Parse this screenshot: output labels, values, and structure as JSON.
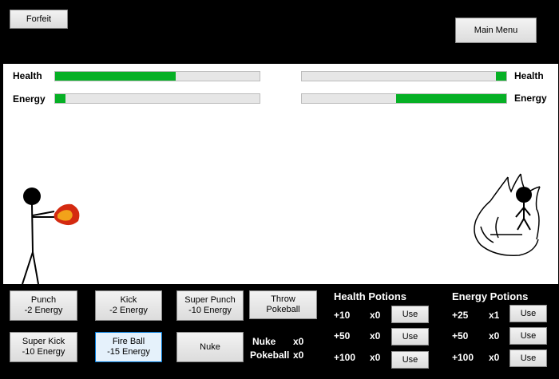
{
  "top": {
    "forfeit": "Forfeit",
    "main_menu": "Main Menu"
  },
  "player": {
    "health_label": "Health",
    "energy_label": "Energy",
    "health": 0.59,
    "energy": 0.05
  },
  "enemy": {
    "health_label": "Health",
    "energy_label": "Energy",
    "health": 0.05,
    "energy": 0.54
  },
  "moves": {
    "punch": "Punch\n-2 Energy",
    "kick": "Kick\n-2 Energy",
    "super_punch": "Super Punch\n-10 Energy",
    "throw_pokeball": "Throw\nPokeball",
    "super_kick": "Super Kick\n-10 Energy",
    "fire_ball": "Fire Ball\n-15 Energy",
    "nuke": "Nuke"
  },
  "inventory": {
    "nuke_label": "Nuke",
    "nuke_count": "x0",
    "pokeball_label": "Pokeball",
    "pokeball_count": "x0"
  },
  "health_potions": {
    "title": "Health Potions",
    "items": [
      {
        "amount": "+10",
        "count": "x0",
        "use": "Use"
      },
      {
        "amount": "+50",
        "count": "x0",
        "use": "Use"
      },
      {
        "amount": "+100",
        "count": "x0",
        "use": "Use"
      }
    ]
  },
  "energy_potions": {
    "title": "Energy Potions",
    "items": [
      {
        "amount": "+25",
        "count": "x1",
        "use": "Use"
      },
      {
        "amount": "+50",
        "count": "x0",
        "use": "Use"
      },
      {
        "amount": "+100",
        "count": "x0",
        "use": "Use"
      }
    ]
  },
  "colors": {
    "bar_fill": "#06b025",
    "bar_track": "#e6e6e6",
    "fireball_outer": "#d42a10",
    "fireball_inner": "#f2a21a"
  }
}
